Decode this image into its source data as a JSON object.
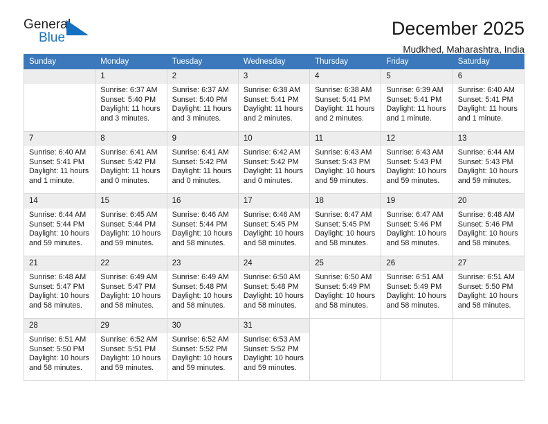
{
  "logo": {
    "word_top": "General",
    "word_bottom": "Blue",
    "triangle_color": "#1471c0"
  },
  "header": {
    "title": "December 2025",
    "subtitle": "Mudkhed, Maharashtra, India"
  },
  "colors": {
    "header_blue": "#3b78bc",
    "daynum_stripe": "#ededed",
    "grid_line": "#d6d6d6",
    "text": "#1a1a1a"
  },
  "labels": {
    "sunrise_prefix": "Sunrise:",
    "sunset_prefix": "Sunset:",
    "daylight_prefix": "Daylight:"
  },
  "weekdays": [
    "Sunday",
    "Monday",
    "Tuesday",
    "Wednesday",
    "Thursday",
    "Friday",
    "Saturday"
  ],
  "weeks": [
    [
      {
        "day": "",
        "blank": true
      },
      {
        "day": "1",
        "sunrise": "Sunrise: 6:37 AM",
        "sunset": "Sunset: 5:40 PM",
        "daylight": "Daylight: 11 hours and 3 minutes."
      },
      {
        "day": "2",
        "sunrise": "Sunrise: 6:37 AM",
        "sunset": "Sunset: 5:40 PM",
        "daylight": "Daylight: 11 hours and 3 minutes."
      },
      {
        "day": "3",
        "sunrise": "Sunrise: 6:38 AM",
        "sunset": "Sunset: 5:41 PM",
        "daylight": "Daylight: 11 hours and 2 minutes."
      },
      {
        "day": "4",
        "sunrise": "Sunrise: 6:38 AM",
        "sunset": "Sunset: 5:41 PM",
        "daylight": "Daylight: 11 hours and 2 minutes."
      },
      {
        "day": "5",
        "sunrise": "Sunrise: 6:39 AM",
        "sunset": "Sunset: 5:41 PM",
        "daylight": "Daylight: 11 hours and 1 minute."
      },
      {
        "day": "6",
        "sunrise": "Sunrise: 6:40 AM",
        "sunset": "Sunset: 5:41 PM",
        "daylight": "Daylight: 11 hours and 1 minute."
      }
    ],
    [
      {
        "day": "7",
        "sunrise": "Sunrise: 6:40 AM",
        "sunset": "Sunset: 5:41 PM",
        "daylight": "Daylight: 11 hours and 1 minute."
      },
      {
        "day": "8",
        "sunrise": "Sunrise: 6:41 AM",
        "sunset": "Sunset: 5:42 PM",
        "daylight": "Daylight: 11 hours and 0 minutes."
      },
      {
        "day": "9",
        "sunrise": "Sunrise: 6:41 AM",
        "sunset": "Sunset: 5:42 PM",
        "daylight": "Daylight: 11 hours and 0 minutes."
      },
      {
        "day": "10",
        "sunrise": "Sunrise: 6:42 AM",
        "sunset": "Sunset: 5:42 PM",
        "daylight": "Daylight: 11 hours and 0 minutes."
      },
      {
        "day": "11",
        "sunrise": "Sunrise: 6:43 AM",
        "sunset": "Sunset: 5:43 PM",
        "daylight": "Daylight: 10 hours and 59 minutes."
      },
      {
        "day": "12",
        "sunrise": "Sunrise: 6:43 AM",
        "sunset": "Sunset: 5:43 PM",
        "daylight": "Daylight: 10 hours and 59 minutes."
      },
      {
        "day": "13",
        "sunrise": "Sunrise: 6:44 AM",
        "sunset": "Sunset: 5:43 PM",
        "daylight": "Daylight: 10 hours and 59 minutes."
      }
    ],
    [
      {
        "day": "14",
        "sunrise": "Sunrise: 6:44 AM",
        "sunset": "Sunset: 5:44 PM",
        "daylight": "Daylight: 10 hours and 59 minutes."
      },
      {
        "day": "15",
        "sunrise": "Sunrise: 6:45 AM",
        "sunset": "Sunset: 5:44 PM",
        "daylight": "Daylight: 10 hours and 59 minutes."
      },
      {
        "day": "16",
        "sunrise": "Sunrise: 6:46 AM",
        "sunset": "Sunset: 5:44 PM",
        "daylight": "Daylight: 10 hours and 58 minutes."
      },
      {
        "day": "17",
        "sunrise": "Sunrise: 6:46 AM",
        "sunset": "Sunset: 5:45 PM",
        "daylight": "Daylight: 10 hours and 58 minutes."
      },
      {
        "day": "18",
        "sunrise": "Sunrise: 6:47 AM",
        "sunset": "Sunset: 5:45 PM",
        "daylight": "Daylight: 10 hours and 58 minutes."
      },
      {
        "day": "19",
        "sunrise": "Sunrise: 6:47 AM",
        "sunset": "Sunset: 5:46 PM",
        "daylight": "Daylight: 10 hours and 58 minutes."
      },
      {
        "day": "20",
        "sunrise": "Sunrise: 6:48 AM",
        "sunset": "Sunset: 5:46 PM",
        "daylight": "Daylight: 10 hours and 58 minutes."
      }
    ],
    [
      {
        "day": "21",
        "sunrise": "Sunrise: 6:48 AM",
        "sunset": "Sunset: 5:47 PM",
        "daylight": "Daylight: 10 hours and 58 minutes."
      },
      {
        "day": "22",
        "sunrise": "Sunrise: 6:49 AM",
        "sunset": "Sunset: 5:47 PM",
        "daylight": "Daylight: 10 hours and 58 minutes."
      },
      {
        "day": "23",
        "sunrise": "Sunrise: 6:49 AM",
        "sunset": "Sunset: 5:48 PM",
        "daylight": "Daylight: 10 hours and 58 minutes."
      },
      {
        "day": "24",
        "sunrise": "Sunrise: 6:50 AM",
        "sunset": "Sunset: 5:48 PM",
        "daylight": "Daylight: 10 hours and 58 minutes."
      },
      {
        "day": "25",
        "sunrise": "Sunrise: 6:50 AM",
        "sunset": "Sunset: 5:49 PM",
        "daylight": "Daylight: 10 hours and 58 minutes."
      },
      {
        "day": "26",
        "sunrise": "Sunrise: 6:51 AM",
        "sunset": "Sunset: 5:49 PM",
        "daylight": "Daylight: 10 hours and 58 minutes."
      },
      {
        "day": "27",
        "sunrise": "Sunrise: 6:51 AM",
        "sunset": "Sunset: 5:50 PM",
        "daylight": "Daylight: 10 hours and 58 minutes."
      }
    ],
    [
      {
        "day": "28",
        "sunrise": "Sunrise: 6:51 AM",
        "sunset": "Sunset: 5:50 PM",
        "daylight": "Daylight: 10 hours and 58 minutes."
      },
      {
        "day": "29",
        "sunrise": "Sunrise: 6:52 AM",
        "sunset": "Sunset: 5:51 PM",
        "daylight": "Daylight: 10 hours and 59 minutes."
      },
      {
        "day": "30",
        "sunrise": "Sunrise: 6:52 AM",
        "sunset": "Sunset: 5:52 PM",
        "daylight": "Daylight: 10 hours and 59 minutes."
      },
      {
        "day": "31",
        "sunrise": "Sunrise: 6:53 AM",
        "sunset": "Sunset: 5:52 PM",
        "daylight": "Daylight: 10 hours and 59 minutes."
      },
      {
        "day": "",
        "blank": true,
        "no_stripe": true
      },
      {
        "day": "",
        "blank": true,
        "no_stripe": true
      },
      {
        "day": "",
        "blank": true,
        "no_stripe": true
      }
    ]
  ]
}
